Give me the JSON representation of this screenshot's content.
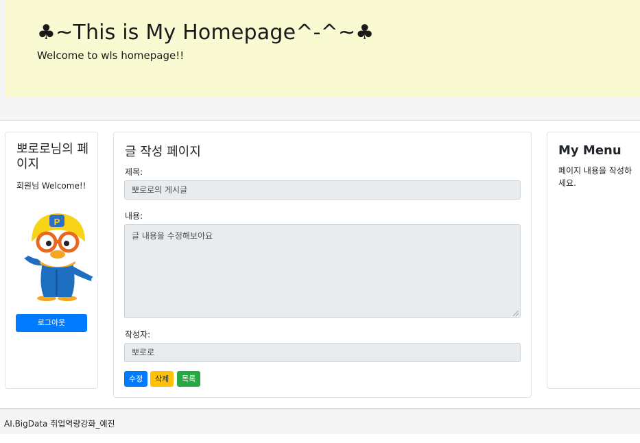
{
  "header": {
    "title": "♣~This is My Homepage^-^~♣",
    "subtitle": "Welcome to wls homepage!!"
  },
  "sidebar_left": {
    "title": "뽀로로님의 페이지",
    "welcome": "회원님 Welcome!!",
    "avatar_icon": "pororo-character-image",
    "logout_label": "로그아웃"
  },
  "main": {
    "page_title": "글 작성 페이지",
    "subject_label": "제목:",
    "subject_value": "뽀로로의 게시글",
    "content_label": "내용:",
    "content_value": "글 내용을 수정해보아요",
    "author_label": "작성자:",
    "author_value": "뽀로로",
    "buttons": {
      "edit": "수정",
      "delete": "삭제",
      "list": "목록"
    }
  },
  "sidebar_right": {
    "title": "My Menu",
    "text": "페이지 내용을 작성하세요."
  },
  "footer": {
    "text": "AI.BigData 취업역량강화_예진"
  },
  "colors": {
    "jumbotron": "#fafad2",
    "primary": "#007bff",
    "warning": "#ffc107",
    "success": "#28a745"
  }
}
